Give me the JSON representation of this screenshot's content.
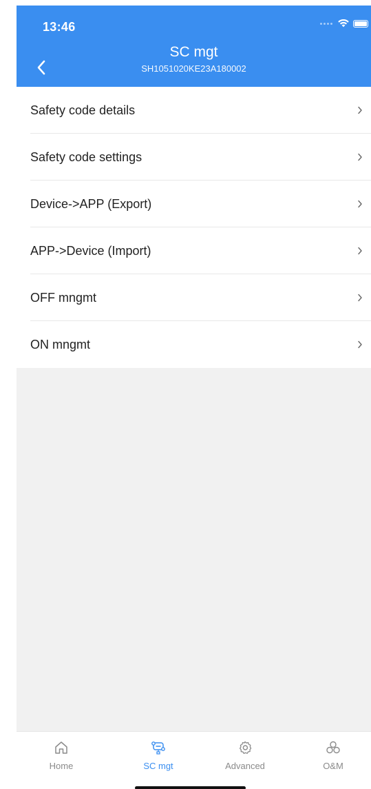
{
  "status_bar": {
    "time": "13:46"
  },
  "header": {
    "title": "SC mgt",
    "subtitle": "SH1051020KE23A180002"
  },
  "menu": {
    "items": [
      {
        "label": "Safety code details"
      },
      {
        "label": "Safety code settings"
      },
      {
        "label": "Device->APP (Export)"
      },
      {
        "label": "APP->Device (Import)"
      },
      {
        "label": "OFF mngmt"
      },
      {
        "label": "ON mngmt"
      }
    ]
  },
  "tabbar": {
    "tabs": [
      {
        "label": "Home",
        "icon": "home-icon",
        "active": false
      },
      {
        "label": "SC mgt",
        "icon": "sc-mgt-icon",
        "active": true
      },
      {
        "label": "Advanced",
        "icon": "gear-icon",
        "active": false
      },
      {
        "label": "O&M",
        "icon": "om-icon",
        "active": false
      }
    ]
  },
  "colors": {
    "accent": "#3a8ef0",
    "background": "#f1f1f1",
    "text": "#222222",
    "inactive": "#8a8a8a"
  }
}
